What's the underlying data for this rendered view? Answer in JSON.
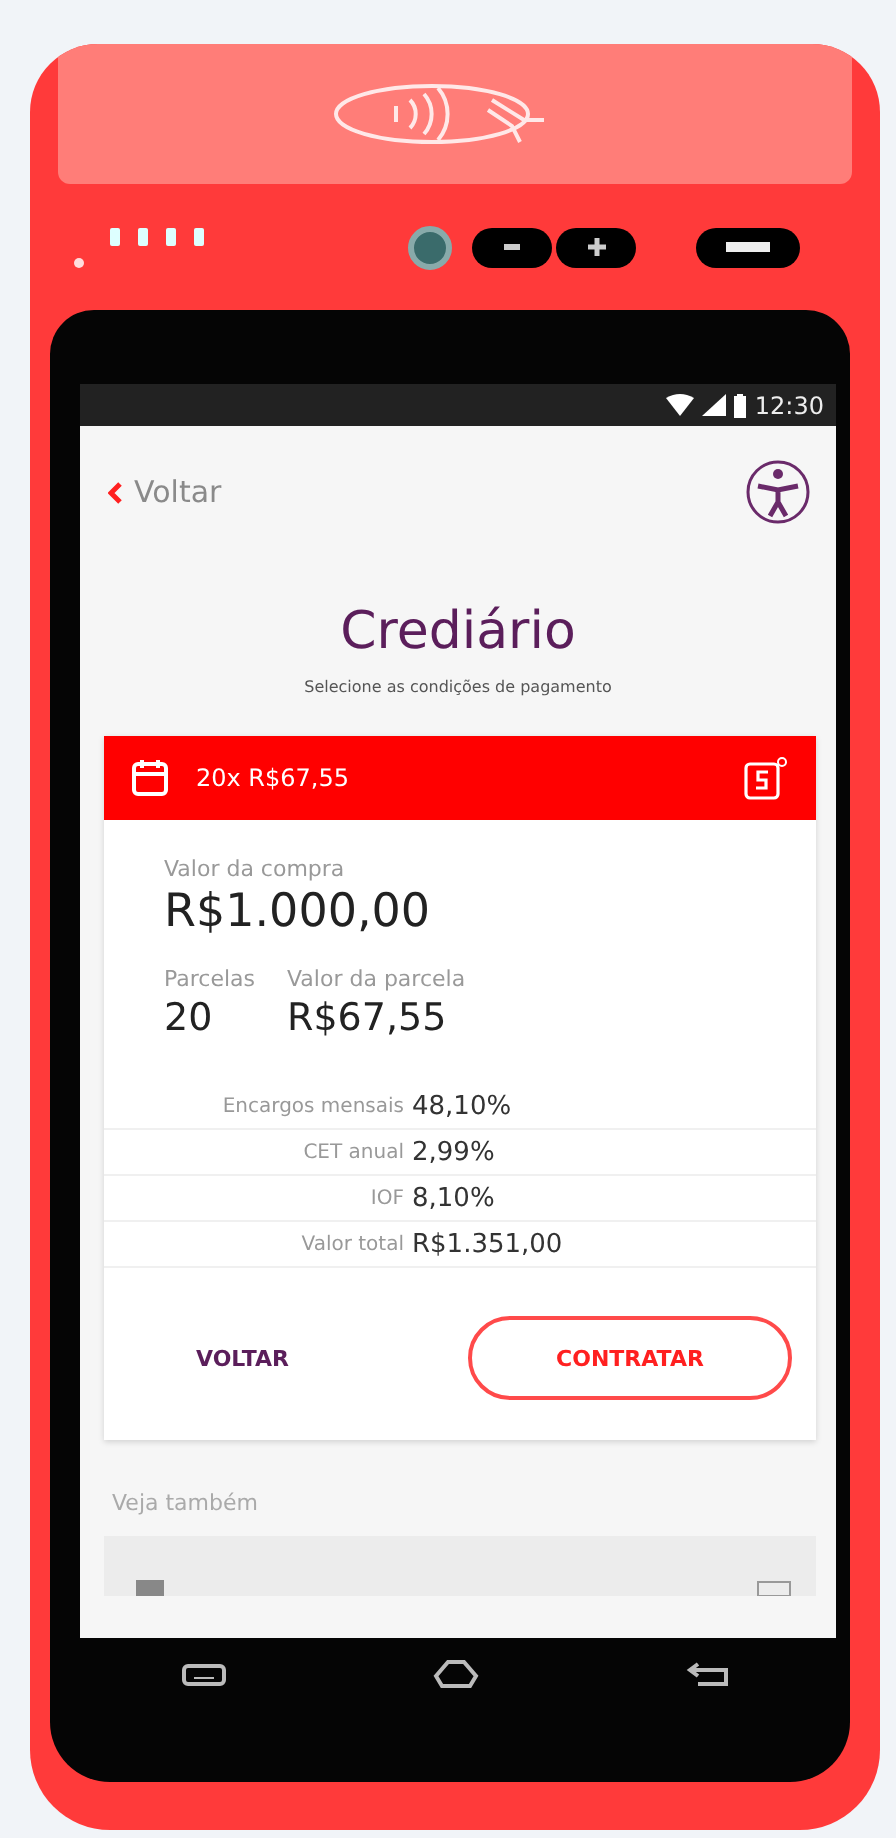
{
  "status_bar": {
    "time": "12:30"
  },
  "header": {
    "back_label": "Voltar"
  },
  "title": "Crediário",
  "subtitle": "Selecione as condições de pagamento",
  "plan": {
    "summary": "20x R$67,55"
  },
  "purchase": {
    "label": "Valor da compra",
    "value": "R$1.000,00"
  },
  "installments": {
    "label": "Parcelas",
    "value": "20"
  },
  "installment_value": {
    "label": "Valor da parcela",
    "value": "R$67,55"
  },
  "fees": [
    {
      "label": "Encargos mensais",
      "value": "48,10%"
    },
    {
      "label": "CET anual",
      "value": "2,99%"
    },
    {
      "label": "IOF",
      "value": "8,10%"
    },
    {
      "label": "Valor total",
      "value": "R$1.351,00"
    }
  ],
  "buttons": {
    "back": "VOLTAR",
    "confirm": "CONTRATAR"
  },
  "see_also": {
    "heading": "Veja também"
  }
}
